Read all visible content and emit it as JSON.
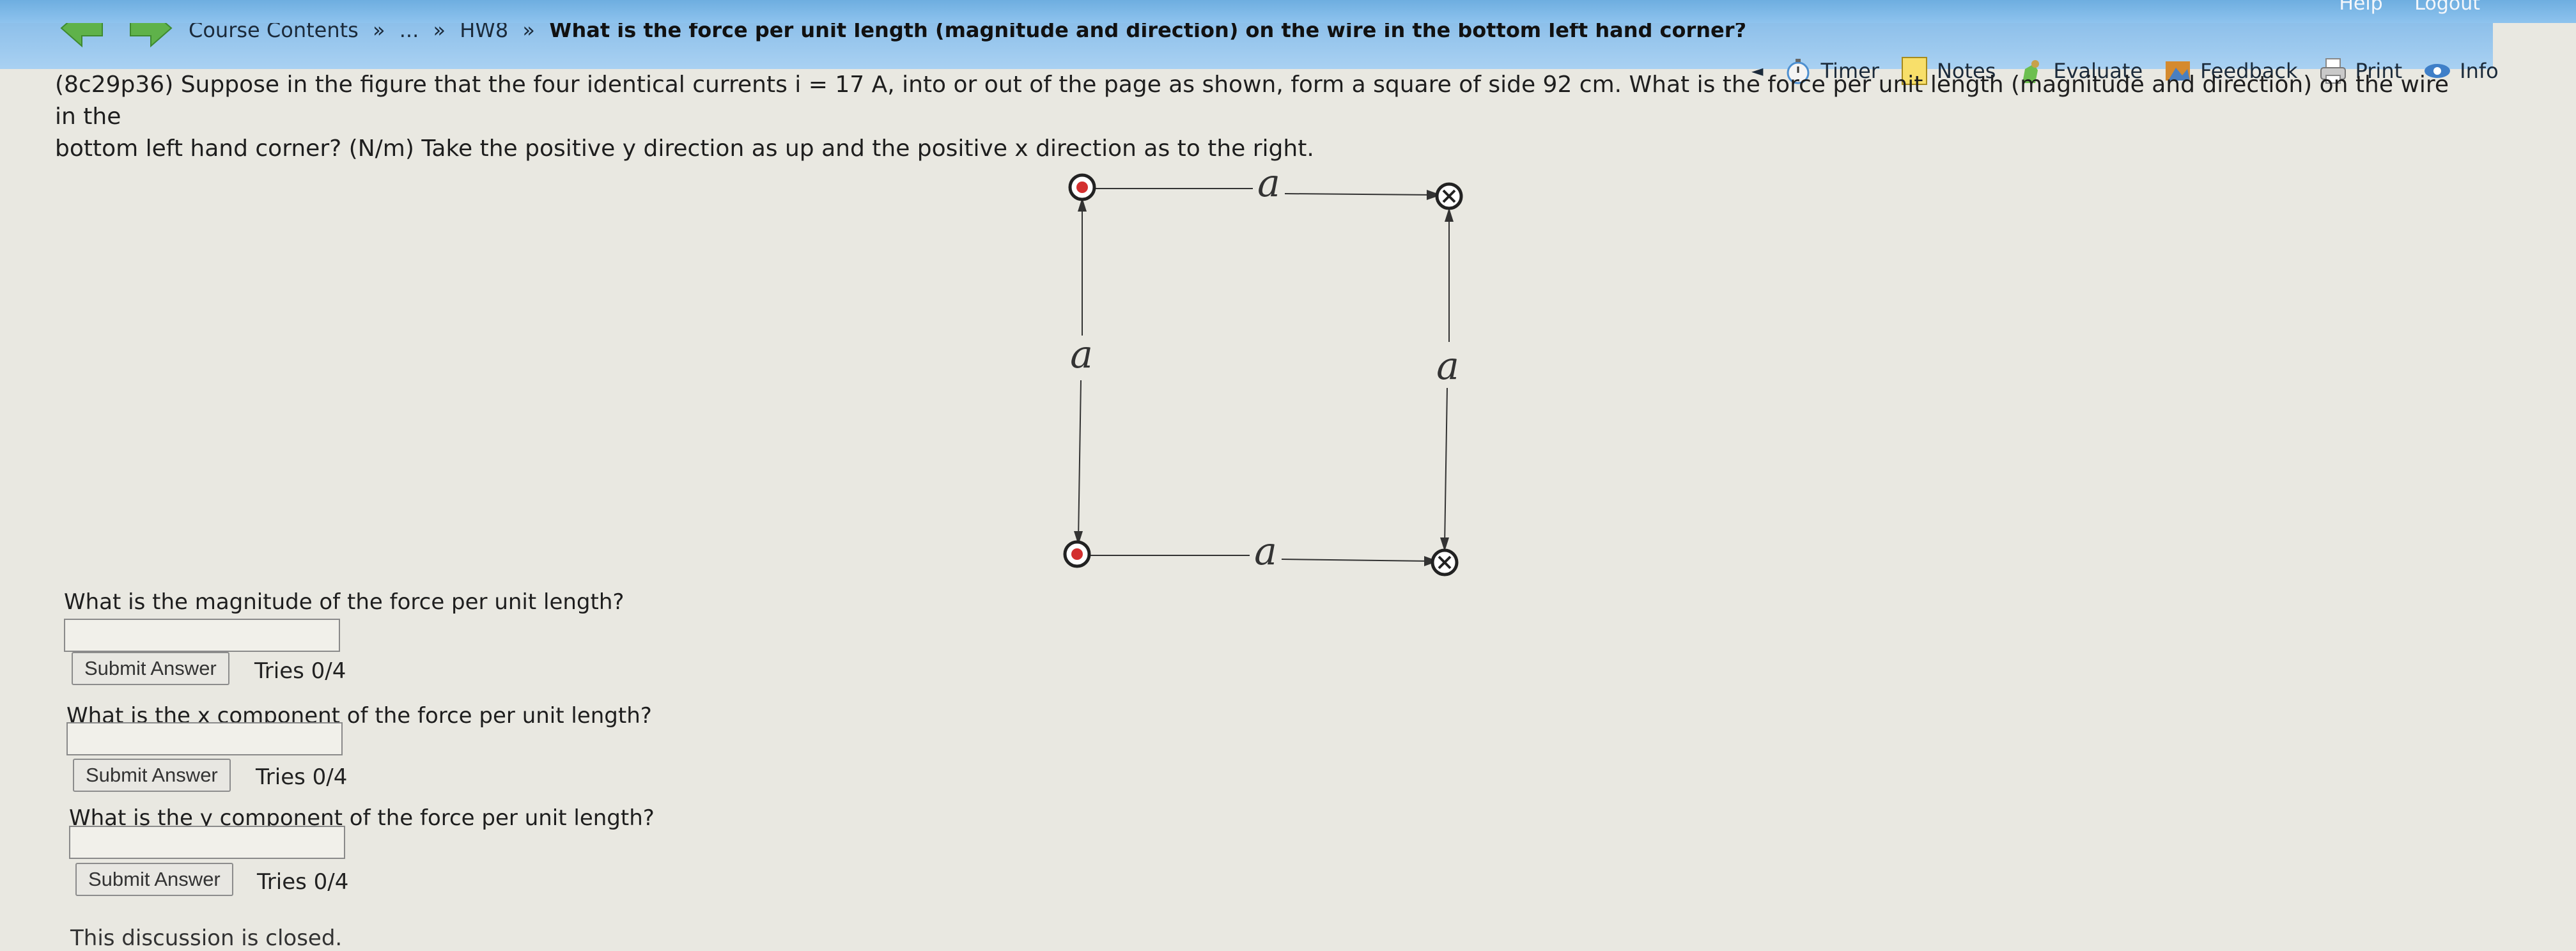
{
  "header": {
    "top_links": [
      "Help",
      "Logout"
    ],
    "breadcrumb": {
      "course": "Course Contents",
      "ellipsis": "...",
      "hw": "HW8",
      "title": "What is the force per unit length (magnitude and direction) on the wire in the bottom left hand corner?"
    },
    "separator": "»",
    "tools": {
      "collapse": "◄",
      "timer": "Timer",
      "notes": "Notes",
      "evaluate": "Evaluate",
      "feedback": "Feedback",
      "print": "Print",
      "info": "Info"
    }
  },
  "problem": {
    "line1": "(8c29p36) Suppose in the figure that the four identical currents i = 17 A, into or out of the page as shown, form a square of side 92 cm. What is the force per unit length (magnitude and direction) on the wire in the",
    "line2": "bottom left hand corner? (N/m) Take the positive y direction as up and the positive x direction as to the right."
  },
  "figure": {
    "label_top": "a",
    "label_bottom": "a",
    "label_left": "a",
    "label_right": "a"
  },
  "questions": [
    {
      "text": "What is the magnitude of the force per unit length?",
      "value": "",
      "submit": "Submit Answer",
      "tries": "Tries 0/4"
    },
    {
      "text": "What is the x component of the force per unit length?",
      "value": "",
      "submit": "Submit Answer",
      "tries": "Tries 0/4"
    },
    {
      "text": "What is the y component of the force per unit length?",
      "value": "",
      "submit": "Submit Answer",
      "tries": "Tries 0/4"
    }
  ],
  "footer": "This discussion is closed.",
  "colors": {
    "header_blue": "#7fb7e6",
    "arrow_green": "#5fb24a",
    "out_dot": "#d32f2f"
  }
}
